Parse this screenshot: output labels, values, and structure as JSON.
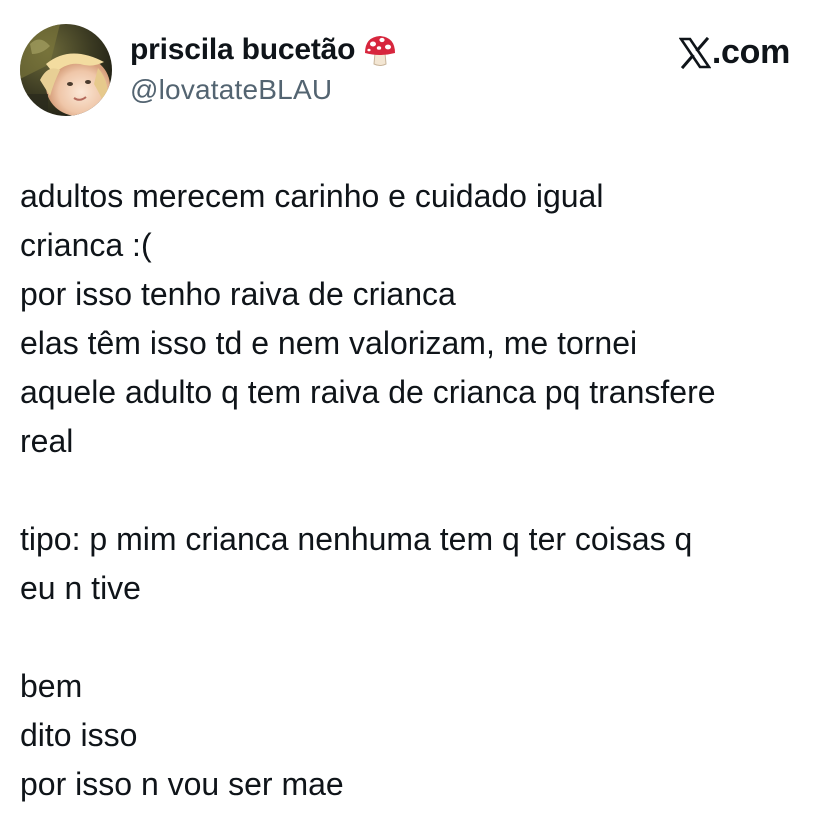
{
  "author": {
    "display_name": "priscila bucetão",
    "handle": "@lovatateBLAU",
    "name_emoji": "mushroom-icon",
    "avatar": "avatar-photo"
  },
  "brand": {
    "logo": "x-logo-icon",
    "text": ".com"
  },
  "tweet": {
    "lines": [
      "adultos merecem carinho e cuidado igual",
      "crianca :(",
      "por isso tenho raiva de crianca",
      "elas têm isso td e nem valorizam, me tornei",
      "aquele adulto q tem raiva de crianca pq transfere",
      "real",
      "",
      "tipo: p mim crianca nenhuma tem q ter coisas q",
      "eu n tive",
      "",
      "bem",
      "dito isso",
      "por isso n vou ser mae"
    ]
  },
  "colors": {
    "text": "#0f1419",
    "secondary": "#536471",
    "background": "#ffffff",
    "mushroom_red": "#d7263d"
  }
}
